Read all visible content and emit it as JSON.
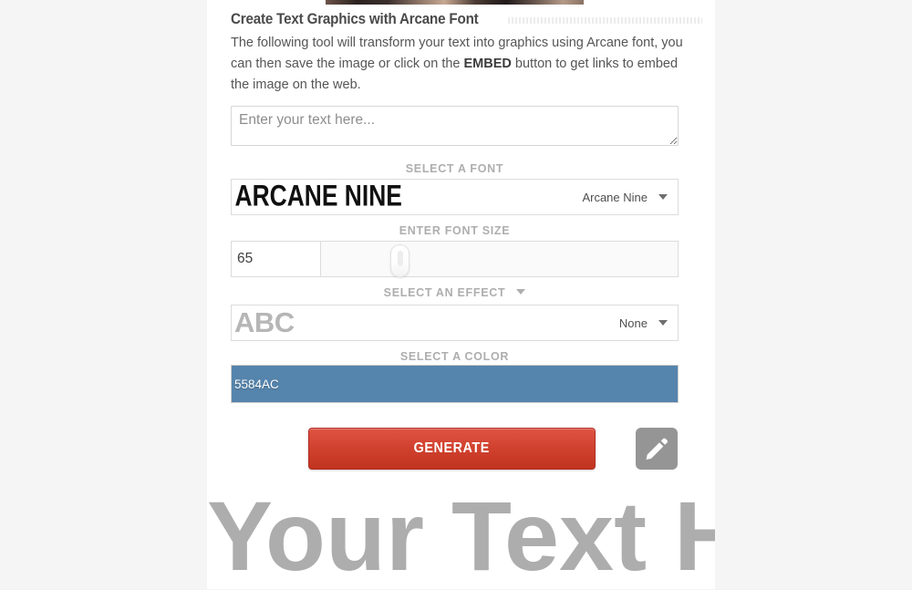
{
  "page": {
    "background_color": "#f5f5f5",
    "content_background": "#ffffff"
  },
  "heading": {
    "title": "Create Text Graphics with Arcane Font"
  },
  "intro": {
    "part1": "The following tool will transform your text into graphics using Arcane font, you can then save the image or click on the ",
    "emphasis": "EMBED",
    "part2": " button to get links to embed the image on the web."
  },
  "text_input": {
    "placeholder": "Enter your text here...",
    "value": ""
  },
  "font_section": {
    "label": "SELECT A FONT",
    "preview_text": "ARCANE NINE",
    "selected": "Arcane Nine",
    "caret_icon": "chevron-down-icon"
  },
  "size_section": {
    "label": "ENTER FONT SIZE",
    "value": "65",
    "slider_percent": 20
  },
  "effect_section": {
    "label": "SELECT AN EFFECT",
    "label_caret_icon": "chevron-down-icon",
    "preview_text": "ABC",
    "selected": "None",
    "caret_icon": "chevron-down-icon"
  },
  "color_section": {
    "label": "SELECT A COLOR",
    "value": "5584AC",
    "swatch_color": "#5584ac",
    "text_color": "#ffffff"
  },
  "actions": {
    "generate_label": "GENERATE",
    "generate_color": "#d1412f",
    "edit_icon": "pencil-icon",
    "edit_button_color": "#959595"
  },
  "output_preview": {
    "text": "Your Text Here",
    "color": "#adadad"
  }
}
